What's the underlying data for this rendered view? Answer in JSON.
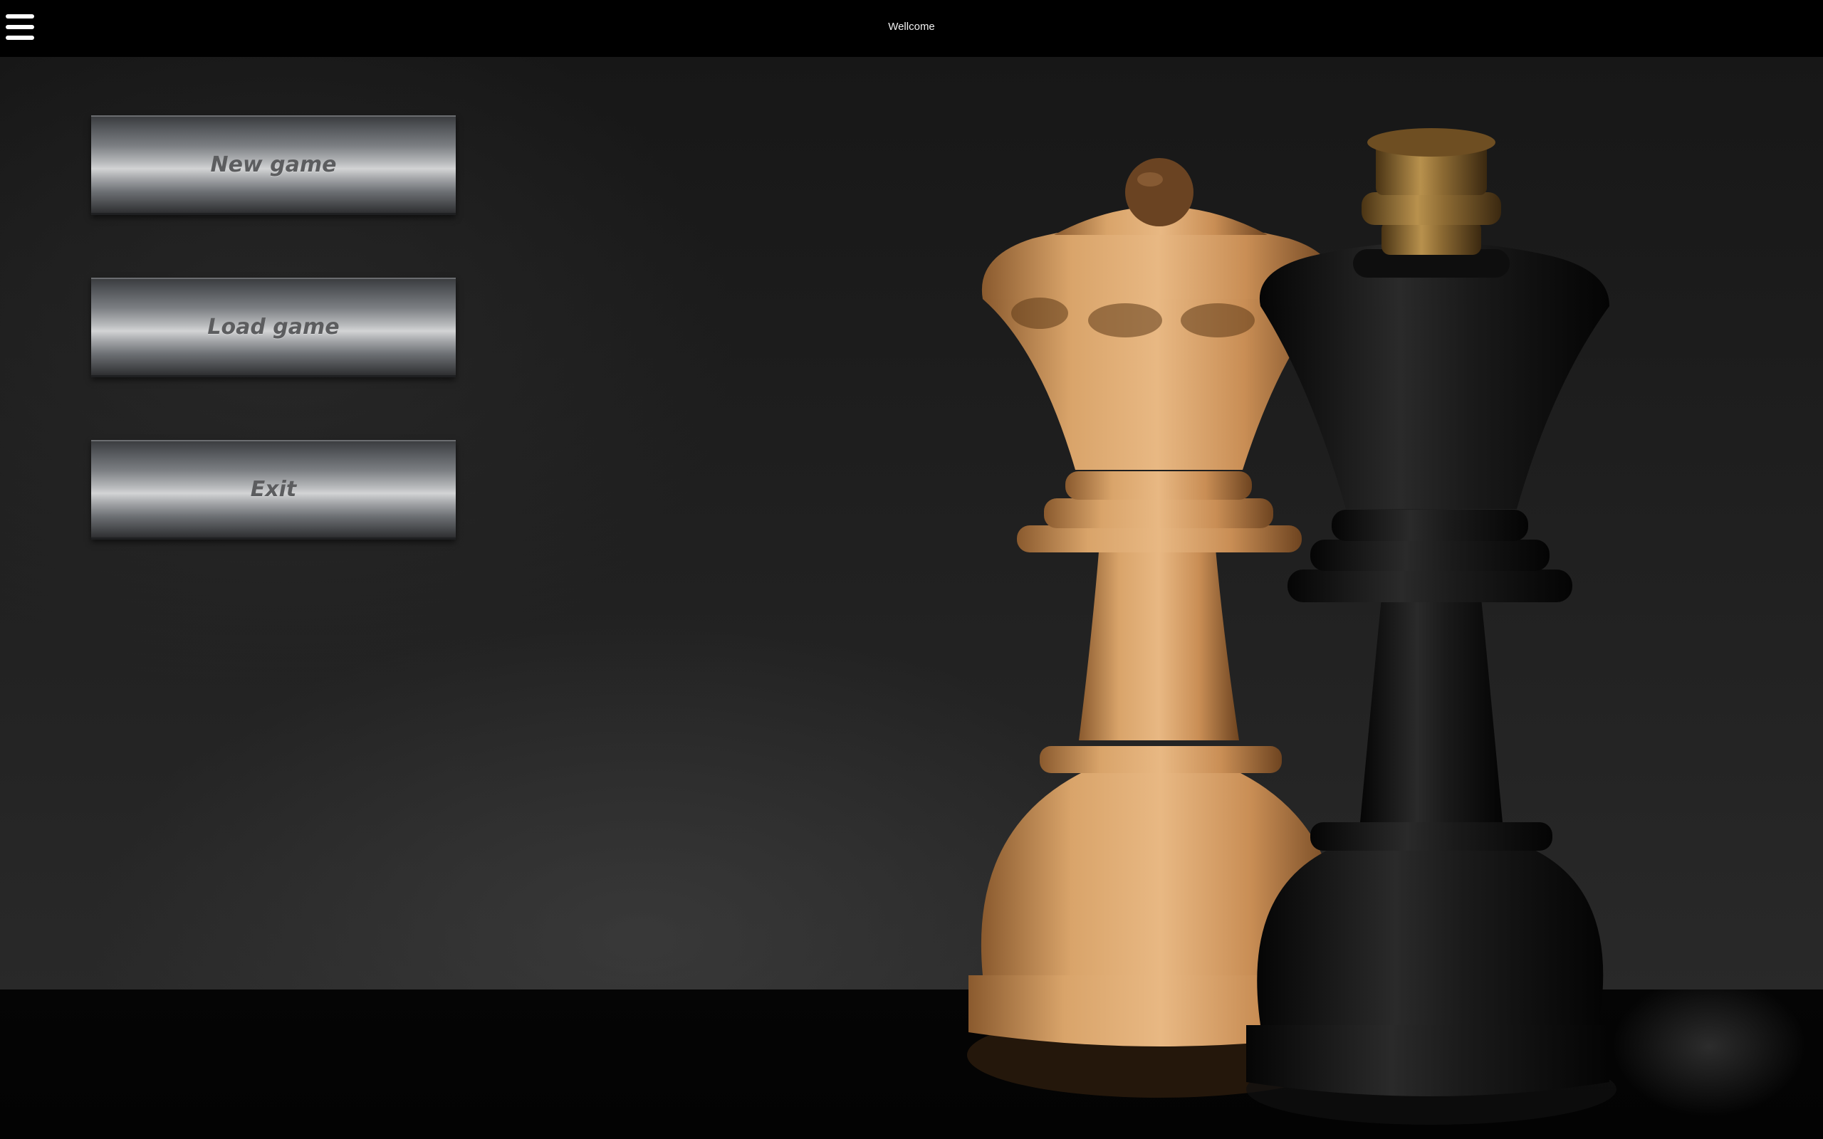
{
  "window": {
    "title": "Wellcome"
  },
  "menu": {
    "new_game": "New game",
    "load_game": "Load game",
    "exit": "Exit"
  },
  "background": {
    "pieces": [
      "queen-piece",
      "king-piece"
    ],
    "wood_color": "#c98e55",
    "ebony_color": "#141414"
  }
}
